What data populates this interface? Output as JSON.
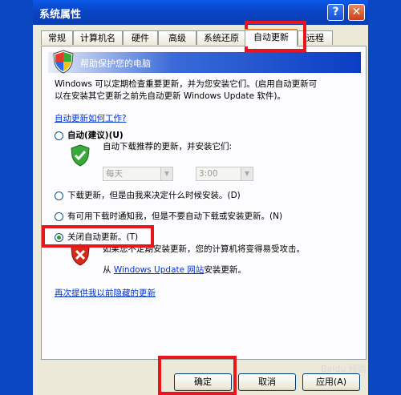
{
  "window": {
    "title": "系统属性",
    "help_glyph": "?",
    "close_glyph": "✕"
  },
  "tabs": [
    {
      "label": "常规"
    },
    {
      "label": "计算机名"
    },
    {
      "label": "硬件"
    },
    {
      "label": "高级"
    },
    {
      "label": "系统还原"
    },
    {
      "label": "自动更新",
      "active": true
    },
    {
      "label": "远程"
    }
  ],
  "banner": {
    "text": "帮助保护您的电脑"
  },
  "intro": {
    "line1": "Windows 可以定期检查重要更新，并为您安装它们。(启用自动更新可",
    "line2": "以在安装其它更新之前先自动更新 Windows Update 软件)。"
  },
  "how_link": "自动更新如何工作?",
  "options": {
    "auto": {
      "label": "自动(建议)(U)",
      "desc": "自动下载推荐的更新，并安装它们:",
      "day": "每天",
      "time": "3:00"
    },
    "download": {
      "label": "下载更新，但是由我来决定什么时候安装。(D)"
    },
    "notify": {
      "label": "有可用下载时通知我，但是不要自动下载或安装更新。(N)"
    },
    "off": {
      "label": "关闭自动更新。(T)",
      "warn": "如果您不定期安装更新，您的计算机将变得易受攻击。",
      "site_prefix": "从",
      "site_link": "Windows Update 网站",
      "site_suffix": "安装更新。"
    }
  },
  "hidden_link": "再次提供我以前隐藏的更新",
  "buttons": {
    "ok": "确定",
    "cancel": "取消",
    "apply": "应用(A)"
  },
  "watermark": "Baidu 经验",
  "colors": {
    "highlight": "#e8161c",
    "title_bar": "#0a47c2"
  }
}
